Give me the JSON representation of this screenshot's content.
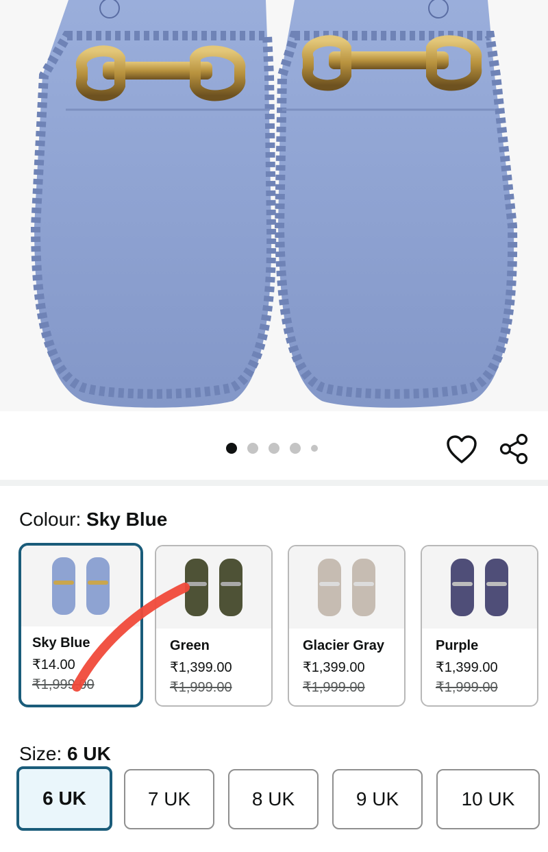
{
  "colour": {
    "label": "Colour: ",
    "selected": "Sky Blue",
    "options": [
      {
        "name": "Sky Blue",
        "price": "₹14.00",
        "mrp": "₹1,999.00",
        "color": "#8ea3d2"
      },
      {
        "name": "Green",
        "price": "₹1,399.00",
        "mrp": "₹1,999.00",
        "color": "#4e5236"
      },
      {
        "name": "Glacier Gray",
        "price": "₹1,399.00",
        "mrp": "₹1,999.00",
        "color": "#c6bcb2"
      },
      {
        "name": "Purple",
        "price": "₹1,399.00",
        "mrp": "₹1,999.00",
        "color": "#4f4e78"
      }
    ]
  },
  "size": {
    "label": "Size: ",
    "selected": "6 UK",
    "options": [
      "6 UK",
      "7 UK",
      "8 UK",
      "9 UK",
      "10 UK"
    ]
  },
  "gallery": {
    "image_count": 5,
    "active_index": 0,
    "shoe_color": "#8fa3d1"
  },
  "icons": {
    "favorite": "heart-icon",
    "share": "share-icon"
  },
  "colors": {
    "selected_border": "#1a5c7a",
    "selected_fill": "#eaf6fb",
    "annotation_stroke": "#f04a3a"
  }
}
